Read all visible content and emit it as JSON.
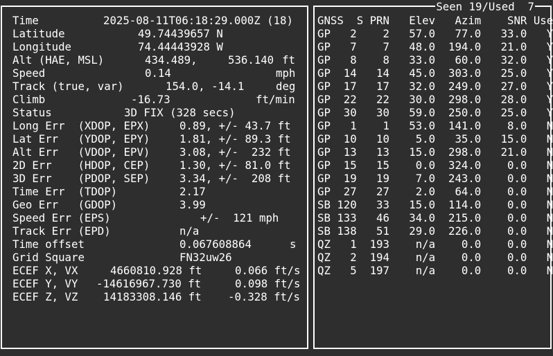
{
  "fix": {
    "time_label": "Time",
    "time_value": "2025-08-11T06:18:29.000Z (18)",
    "lat_label": "Latitude",
    "lat_value": "49.74439657 N",
    "lon_label": "Longitude",
    "lon_value": "74.44443928 W",
    "alt_label": "Alt (HAE, MSL)",
    "alt_hae": "434.489,",
    "alt_msl": "536.140",
    "alt_unit": "ft",
    "speed_label": "Speed",
    "speed_value": "0.14",
    "speed_unit": "mph",
    "track_label": "Track (true, var)",
    "track_value": "154.0, -14.1",
    "track_unit": "deg",
    "climb_label": "Climb",
    "climb_value": "-16.73",
    "climb_unit": "ft/min",
    "status_label": "Status",
    "status_value": "3D FIX (328 secs)",
    "long_err_label": "Long Err  (XDOP, EPX)",
    "long_err_value": "0.89, +/- 43.7 ft",
    "lat_err_label": "Lat Err   (YDOP, EPY)",
    "lat_err_value": "1.81, +/- 89.3 ft",
    "alt_err_label": "Alt Err   (VDOP, EPV)",
    "alt_err_value": "3.08, +/-  232 ft",
    "err2d_label": "2D Err    (HDOP, CEP)",
    "err2d_value": "1.30, +/- 81.0 ft",
    "err3d_label": "3D Err    (PDOP, SEP)",
    "err3d_value": "3.34, +/-  208 ft",
    "time_err_label": "Time Err  (TDOP)",
    "time_err_value": "2.17",
    "geo_err_label": "Geo Err   (GDOP)",
    "geo_err_value": "3.99",
    "speed_err_label": "Speed Err (EPS)",
    "speed_err_value": "+/-  121 mph",
    "track_err_label": "Track Err (EPD)",
    "track_err_value": "n/a",
    "time_offset_label": "Time offset",
    "time_offset_value": "0.067608864",
    "time_offset_unit": "s",
    "grid_label": "Grid Square",
    "grid_value": "FN32uw26",
    "ecef_x_label": "ECEF X, VX",
    "ecef_x_pos": "4660810.928 ft",
    "ecef_x_vel": "0.066 ft/s",
    "ecef_y_label": "ECEF Y, VY",
    "ecef_y_pos": "-14616967.730 ft",
    "ecef_y_vel": "0.098 ft/s",
    "ecef_z_label": "ECEF Z, VZ",
    "ecef_z_pos": "14183308.146 ft",
    "ecef_z_vel": "-0.328 ft/s"
  },
  "sky": {
    "title": "Seen 19/Used  7",
    "headers": [
      "GNSS",
      "S",
      "PRN",
      "Elev",
      "Azim",
      "SNR",
      "Use"
    ],
    "sats": [
      [
        "GP",
        "2",
        "2",
        "57.0",
        "77.0",
        "33.0",
        "Y"
      ],
      [
        "GP",
        "7",
        "7",
        "48.0",
        "194.0",
        "21.0",
        "Y"
      ],
      [
        "GP",
        "8",
        "8",
        "33.0",
        "60.0",
        "32.0",
        "Y"
      ],
      [
        "GP",
        "14",
        "14",
        "45.0",
        "303.0",
        "25.0",
        "Y"
      ],
      [
        "GP",
        "17",
        "17",
        "32.0",
        "249.0",
        "27.0",
        "Y"
      ],
      [
        "GP",
        "22",
        "22",
        "30.0",
        "298.0",
        "28.0",
        "Y"
      ],
      [
        "GP",
        "30",
        "30",
        "59.0",
        "250.0",
        "25.0",
        "Y"
      ],
      [
        "GP",
        "1",
        "1",
        "53.0",
        "141.0",
        "8.0",
        "N"
      ],
      [
        "GP",
        "10",
        "10",
        "5.0",
        "35.0",
        "15.0",
        "N"
      ],
      [
        "GP",
        "13",
        "13",
        "15.0",
        "298.0",
        "21.0",
        "N"
      ],
      [
        "GP",
        "15",
        "15",
        "0.0",
        "324.0",
        "0.0",
        "N"
      ],
      [
        "GP",
        "19",
        "19",
        "7.0",
        "243.0",
        "0.0",
        "N"
      ],
      [
        "GP",
        "27",
        "27",
        "2.0",
        "64.0",
        "0.0",
        "N"
      ],
      [
        "SB",
        "120",
        "33",
        "15.0",
        "114.0",
        "0.0",
        "N"
      ],
      [
        "SB",
        "133",
        "46",
        "34.0",
        "215.0",
        "0.0",
        "N"
      ],
      [
        "SB",
        "138",
        "51",
        "29.0",
        "226.0",
        "0.0",
        "N"
      ],
      [
        "QZ",
        "1",
        "193",
        "n/a",
        "0.0",
        "0.0",
        "N"
      ],
      [
        "QZ",
        "2",
        "194",
        "n/a",
        "0.0",
        "0.0",
        "N"
      ],
      [
        "QZ",
        "5",
        "197",
        "n/a",
        "0.0",
        "0.0",
        "N"
      ]
    ]
  }
}
